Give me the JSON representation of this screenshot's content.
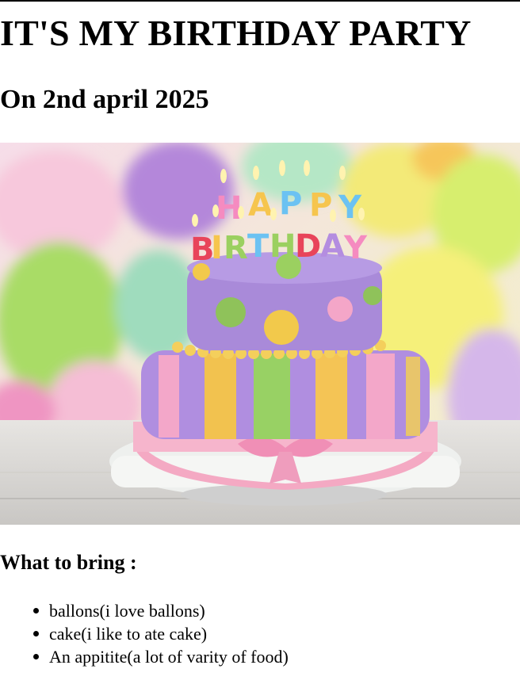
{
  "page": {
    "title": "IT'S MY BIRTHDAY PARTY",
    "subtitle": "On 2nd april 2025",
    "image_text": "HAPPY BIRTHDAY",
    "bring_heading": "What to bring :",
    "bring_items": [
      "ballons(i love ballons)",
      "cake(i like to ate cake)",
      "An appitite(a lot of varity of food)"
    ]
  },
  "colors": {
    "text": "#000000",
    "background": "#ffffff"
  }
}
